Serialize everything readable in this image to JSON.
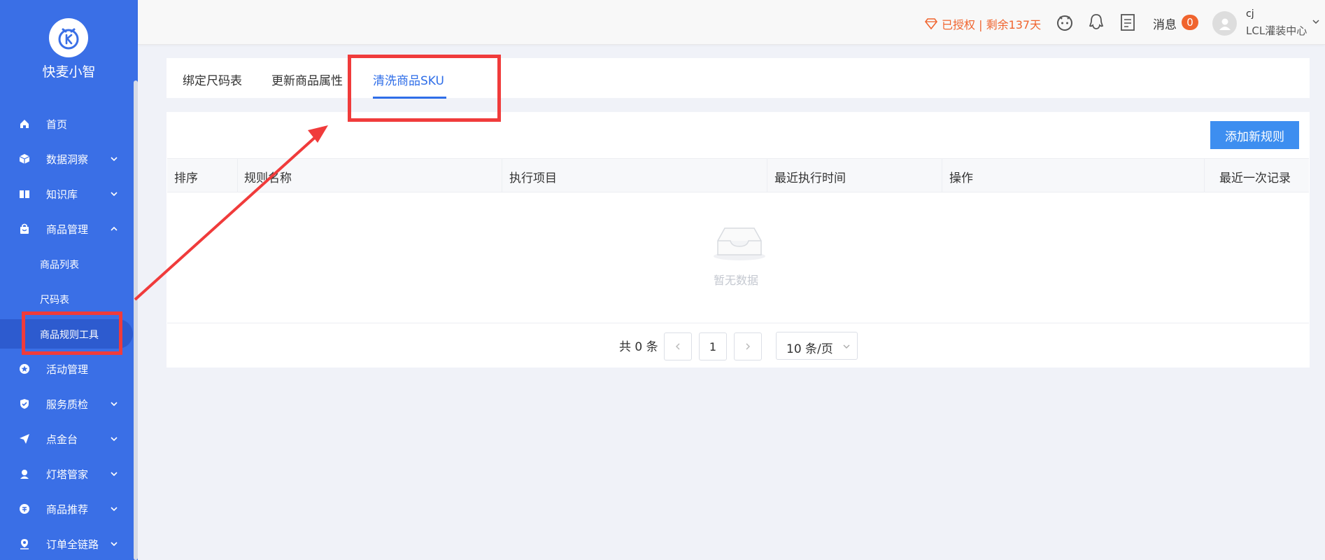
{
  "sidebar": {
    "brand": "快麦小智",
    "menu": [
      {
        "label": "首页",
        "icon": "home-icon"
      },
      {
        "label": "数据洞察",
        "icon": "cube-icon"
      },
      {
        "label": "知识库",
        "icon": "book-icon"
      },
      {
        "label": "商品管理",
        "icon": "bag-icon"
      },
      {
        "label": "活动管理",
        "icon": "star-icon"
      },
      {
        "label": "服务质检",
        "icon": "shield-check-icon"
      },
      {
        "label": "点金台",
        "icon": "paper-plane-icon"
      },
      {
        "label": "灯塔管家",
        "icon": "person-icon"
      },
      {
        "label": "商品推荐",
        "icon": "recommend-icon"
      },
      {
        "label": "订单全链路",
        "icon": "location-icon"
      }
    ],
    "submenu": [
      {
        "label": "商品列表"
      },
      {
        "label": "尺码表"
      },
      {
        "label": "商品规则工具"
      }
    ],
    "active_submenu": "商品规则工具"
  },
  "header": {
    "auth": "已授权 | 剩余137天",
    "message_label": "消息",
    "message_count": "0",
    "user_name": "cj",
    "user_org": "LCL灌装中心"
  },
  "tabs": [
    {
      "label": "绑定尺码表"
    },
    {
      "label": "更新商品属性"
    },
    {
      "label": "清洗商品SKU"
    }
  ],
  "active_tab": "清洗商品SKU",
  "toolbar": {
    "add_rule": "添加新规则"
  },
  "table": {
    "columns": [
      "排序",
      "规则名称",
      "执行项目",
      "最近执行时间",
      "操作",
      "最近一次记录"
    ],
    "rows": [],
    "empty_text": "暂无数据"
  },
  "pagination": {
    "total": "共 0 条",
    "current_page": "1",
    "page_size": "10 条/页"
  },
  "colors": {
    "sidebar_bg": "#3a6fe6",
    "primary": "#2f6ee8",
    "button": "#3d8ef0",
    "warning": "#f0642e",
    "annotation": "#f03b3b"
  }
}
